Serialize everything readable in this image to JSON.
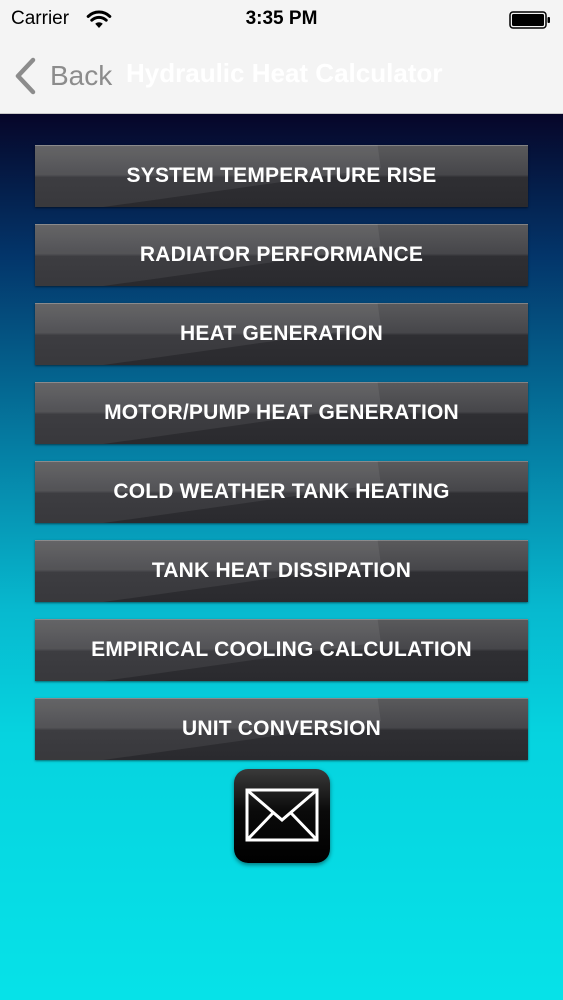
{
  "status_bar": {
    "carrier": "Carrier",
    "time": "3:35 PM",
    "wifi_icon": "wifi-icon",
    "battery_icon": "battery-icon"
  },
  "nav": {
    "back_label": "Back",
    "title": "Hydraulic Heat Calculator",
    "title_color": "#ffffff",
    "back_color": "#8c8c8c"
  },
  "menu": {
    "items": [
      {
        "label": "SYSTEM TEMPERATURE RISE"
      },
      {
        "label": "RADIATOR PERFORMANCE"
      },
      {
        "label": "HEAT GENERATION"
      },
      {
        "label": "MOTOR/PUMP HEAT GENERATION"
      },
      {
        "label": "COLD WEATHER TANK HEATING"
      },
      {
        "label": "TANK HEAT DISSIPATION"
      },
      {
        "label": "EMPIRICAL COOLING CALCULATION"
      },
      {
        "label": "UNIT CONVERSION"
      }
    ],
    "mail_icon": "envelope-icon"
  },
  "colors": {
    "background_top": "#060629",
    "background_bottom": "#06e2e8",
    "button": "#3a3a3e",
    "button_text": "#ffffff"
  }
}
